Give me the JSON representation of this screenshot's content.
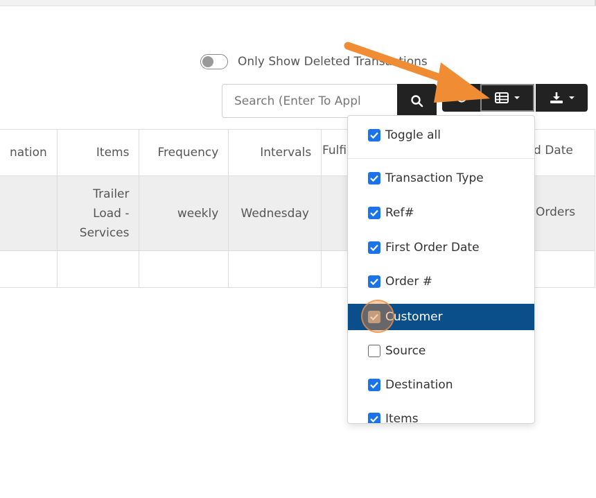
{
  "filter": {
    "deleted_toggle_label": "Only Show Deleted Transactions"
  },
  "search": {
    "placeholder": "Search (Enter To Appl"
  },
  "table": {
    "headers": [
      "nation",
      "Items",
      "Frequency",
      "Intervals",
      "Fulfi",
      "d Date"
    ],
    "row": {
      "items_line1": "Trailer",
      "items_line2": "Load -",
      "items_line3": "Services",
      "frequency": "weekly",
      "intervals": "Wednesday",
      "last": "Orders"
    }
  },
  "column_menu": {
    "items": [
      {
        "label": "Toggle all",
        "checked": true
      },
      {
        "label": "Transaction Type",
        "checked": true
      },
      {
        "label": "Ref#",
        "checked": true
      },
      {
        "label": "First Order Date",
        "checked": true
      },
      {
        "label": "Order #",
        "checked": true
      },
      {
        "label": "Customer",
        "checked": true,
        "highlighted": true
      },
      {
        "label": "Source",
        "checked": false
      },
      {
        "label": "Destination",
        "checked": true
      },
      {
        "label": "Items",
        "checked": true
      }
    ]
  },
  "colors": {
    "accent": "#1a73e8",
    "highlight": "#0b4f8a",
    "toolbar": "#222222",
    "annotation_arrow": "#ef8c34"
  }
}
